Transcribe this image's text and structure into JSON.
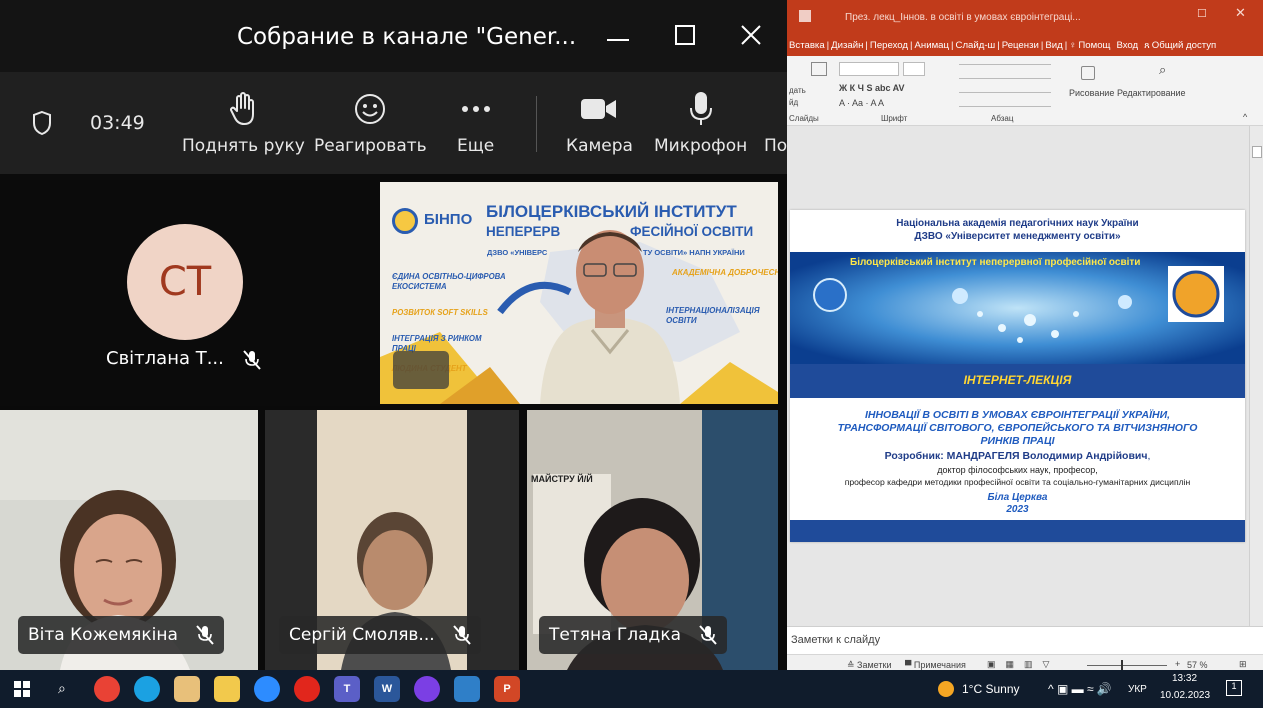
{
  "teams": {
    "window_title": "Собрание в канале \"Gener...",
    "timer": "03:49",
    "toolbar": {
      "raise_hand": "Поднять руку",
      "react": "Реагировать",
      "more": "Еще",
      "camera": "Камера",
      "mic": "Микрофон",
      "share_partial": "По"
    },
    "avatar_initials": "СТ",
    "participants": {
      "svitlana": "Світлана Т...",
      "vita": "Віта Кожемякіна",
      "serhii": "Сергій Смоляв...",
      "tetiana": "Тетяна Гладка"
    },
    "banner": {
      "logo_text": "БІНПО",
      "line1": "БІЛОЦЕРКІВСЬКИЙ ІНСТИТУТ",
      "line2a": "НЕПЕРЕРВ",
      "line2b": "ФЕСІЙНОЇ ОСВІТИ",
      "line3a": "ДЗВО «УНІВЕРС",
      "line3b": "ТУ ОСВІТИ» НАПН УКРАЇНИ",
      "bullet1a": "ЄДИНА ОСВІТНЬО-ЦИФРОВА",
      "bullet1b": "ЕКОСИСТЕМА",
      "bullet2": "РОЗВИТОК SOFT SKILLS",
      "bullet3a": "ІНТЕГРАЦІЯ З РИНКОМ",
      "bullet3b": "ПРАЦІ",
      "bullet4": "ЛЮДИНА СТУДЕНТ",
      "right1": "АКАДЕМІЧНА ДОБРОЧЕСНІСТЬ",
      "right2a": "ІНТЕРНАЦІОНАЛІЗАЦІЯ",
      "right2b": "ОСВІТИ"
    },
    "poster_text": "МАЙСТРУ Й/Й"
  },
  "ppt": {
    "title": "През. лекц_Іннов. в освіті в умовах євроінтеграці...",
    "tabs": [
      "Вставка",
      "Дизайн",
      "Переход",
      "Анимац",
      "Слайд-ш",
      "Рецензи",
      "Вид"
    ],
    "tell_me": "Помощ",
    "sign_in": "Вход",
    "share": "Общий доступ",
    "ribbon": {
      "paste_a": "дать",
      "paste_b": "йд",
      "slides_group": "Слайды",
      "font_group": "Шрифт",
      "para_group": "Абзац",
      "drawing": "Рисование",
      "editing": "Редактирование",
      "font_sample": "Ж К Ч S abc AV",
      "font_sample2": "A · Aa · A A"
    },
    "slide": {
      "head1": "Національна академія педагогічних наук України",
      "head2": "ДЗВО «Університет менеджменту освіти»",
      "banner": "Білоцерківський інститут неперервної професійної освіти",
      "lecture": "ІНТЕРНЕТ-ЛЕКЦІЯ",
      "topic1": "ІННОВАЦІЇ  В ОСВІТІ В УМОВАХ ЄВРОІНТЕГРАЦІЇ УКРАЇНИ,",
      "topic2": "ТРАНСФОРМАЦІЇ СВІТОВОГО, ЄВРОПЕЙСЬКОГО ТА ВІТЧИЗНЯНОГО",
      "topic3": "РИНКІВ ПРАЦІ",
      "author_label": "Розробник: ",
      "author_name": "МАНДРАГЕЛЯ Володимир Андрійович",
      "author_comma": ",",
      "degree": "доктор філософських наук, професор,",
      "position": "професор кафедри методики професійної освіти та соціально-гуманітарних дисциплін",
      "city": "Біла Церква",
      "year": "2023"
    },
    "notes_placeholder": "Заметки к слайду",
    "status": {
      "notes": "Заметки",
      "comments": "Примечания",
      "zoom": "57 %"
    }
  },
  "taskbar": {
    "weather": "1°C  Sunny",
    "lang": "УКР",
    "time": "13:32",
    "date": "10.02.2023",
    "notif_count": "1"
  },
  "colors": {
    "teams_bg": "#0a0a0a",
    "ppt_accent": "#c13b1b",
    "slide_band": "#1f4b9a",
    "avatar_bg": "#f0d4c6",
    "avatar_text": "#a0391f"
  }
}
